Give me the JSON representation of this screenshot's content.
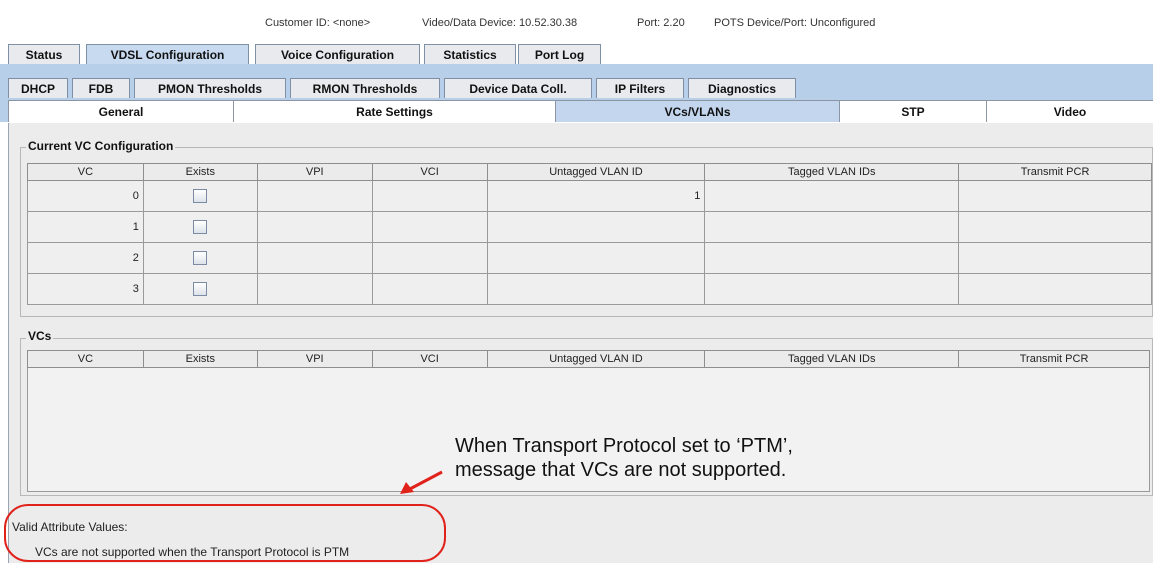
{
  "header": {
    "customer_label": "Customer ID:",
    "customer_value": "<none>",
    "device_label": "Video/Data Device:",
    "device_value": "10.52.30.38",
    "port_label": "Port:",
    "port_value": "2.20",
    "pots_label": "POTS Device/Port:",
    "pots_value": "Unconfigured"
  },
  "tabs_main": [
    "Status",
    "VDSL Configuration",
    "Voice Configuration",
    "Statistics",
    "Port Log"
  ],
  "tabs_sub": [
    "DHCP",
    "FDB",
    "PMON Thresholds",
    "RMON Thresholds",
    "Device Data Coll.",
    "IP Filters",
    "Diagnostics"
  ],
  "tabs_third": [
    "General",
    "Rate Settings",
    "VCs/VLANs",
    "STP",
    "Video"
  ],
  "current_vc": {
    "title": "Current VC Configuration",
    "columns": [
      "VC",
      "Exists",
      "VPI",
      "VCI",
      "Untagged VLAN ID",
      "Tagged VLAN IDs",
      "Transmit PCR"
    ],
    "rows": [
      {
        "vc": "0",
        "vpi": "",
        "vci": "",
        "untagged": "1",
        "tagged": "",
        "pcr": ""
      },
      {
        "vc": "1",
        "vpi": "",
        "vci": "",
        "untagged": "",
        "tagged": "",
        "pcr": ""
      },
      {
        "vc": "2",
        "vpi": "",
        "vci": "",
        "untagged": "",
        "tagged": "",
        "pcr": ""
      },
      {
        "vc": "3",
        "vpi": "",
        "vci": "",
        "untagged": "",
        "tagged": "",
        "pcr": ""
      }
    ]
  },
  "vcs": {
    "title": "VCs",
    "columns": [
      "VC",
      "Exists",
      "VPI",
      "VCI",
      "Untagged VLAN ID",
      "Tagged VLAN IDs",
      "Transmit PCR"
    ]
  },
  "annotation": {
    "line1": "When Transport Protocol set to ‘PTM’,",
    "line2": "message that VCs are not supported."
  },
  "valid": {
    "label": "Valid Attribute Values:",
    "message": "VCs are not supported when the Transport Protocol is PTM"
  },
  "colors": {
    "tab_band": "#b7cfe9",
    "active_tab": "#c3d6ee",
    "annotation_red": "#e0221b"
  }
}
